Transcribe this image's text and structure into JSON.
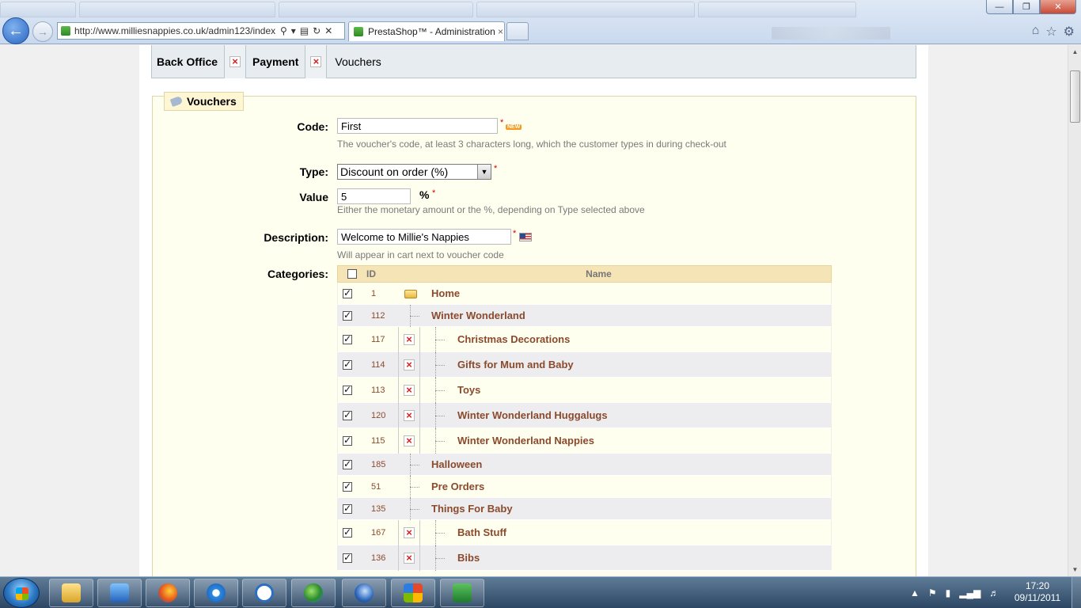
{
  "browser": {
    "url": "http://www.milliesnappies.co.uk/admin123/index",
    "tab_title": "PrestaShop™ - Administration",
    "tab_close": "×"
  },
  "breadcrumb": {
    "items": [
      "Back Office",
      "Payment"
    ],
    "current": "Vouchers"
  },
  "form": {
    "legend": "Vouchers",
    "code": {
      "label": "Code:",
      "value": "First",
      "hint": "The voucher's code, at least 3 characters long, which the customer types in during check-out",
      "badge": "NEW"
    },
    "type": {
      "label": "Type:",
      "value": "Discount on order (%)"
    },
    "value": {
      "label": "Value",
      "value": "5",
      "unit": "%",
      "hint": "Either the monetary amount or the %, depending on Type selected above"
    },
    "description": {
      "label": "Description:",
      "value": "Welcome to Millie's Nappies",
      "hint": "Will appear in cart next to voucher code"
    },
    "categories": {
      "label": "Categories:",
      "columns": {
        "id": "ID",
        "name": "Name"
      },
      "rows": [
        {
          "id": "1",
          "name": "Home",
          "level": 0,
          "checked": true
        },
        {
          "id": "112",
          "name": "Winter Wonderland",
          "level": 1,
          "checked": true
        },
        {
          "id": "117",
          "name": "Christmas Decorations",
          "level": 2,
          "checked": true
        },
        {
          "id": "114",
          "name": "Gifts for Mum and Baby",
          "level": 2,
          "checked": true
        },
        {
          "id": "113",
          "name": "Toys",
          "level": 2,
          "checked": true
        },
        {
          "id": "120",
          "name": "Winter Wonderland Huggalugs",
          "level": 2,
          "checked": true
        },
        {
          "id": "115",
          "name": "Winter Wonderland Nappies",
          "level": 2,
          "checked": true
        },
        {
          "id": "185",
          "name": "Halloween",
          "level": 1,
          "checked": true
        },
        {
          "id": "51",
          "name": "Pre Orders",
          "level": 1,
          "checked": true
        },
        {
          "id": "135",
          "name": "Things For Baby",
          "level": 1,
          "checked": true
        },
        {
          "id": "167",
          "name": "Bath Stuff",
          "level": 2,
          "checked": true
        },
        {
          "id": "136",
          "name": "Bibs",
          "level": 2,
          "checked": true
        }
      ]
    }
  },
  "taskbar": {
    "time": "17:20",
    "date": "09/11/2011"
  }
}
